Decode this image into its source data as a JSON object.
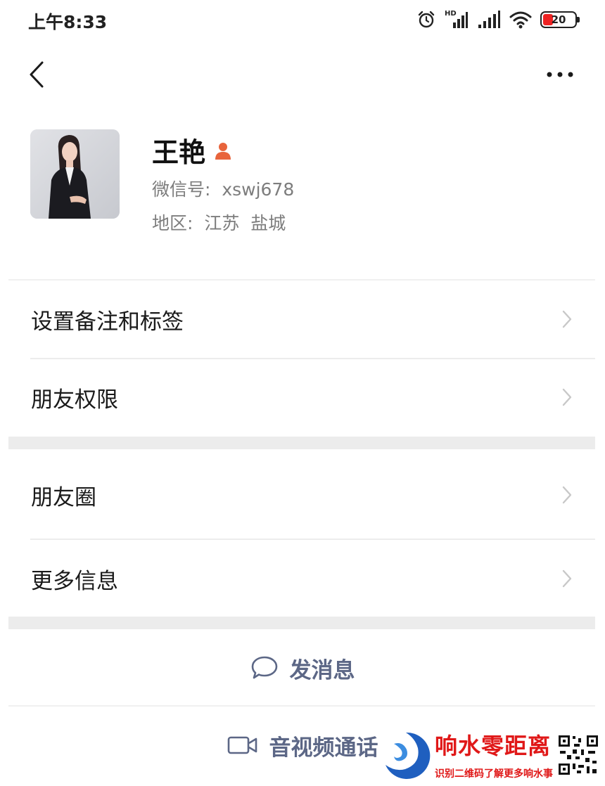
{
  "status_bar": {
    "time": "上午8:33",
    "network_label": "HD",
    "battery": "20",
    "battery_color": "#e22222"
  },
  "nav": {
    "back_icon": "chevron-left-icon",
    "more_icon": "more-dots-icon"
  },
  "profile": {
    "name": "王艳",
    "badge_icon": "person-badge-icon",
    "badge_color": "#e8643c",
    "wechat_id": "微信号:  xswj678",
    "region": "地区:  江苏  盐城"
  },
  "menu": {
    "items": [
      {
        "label": "设置备注和标签"
      },
      {
        "label": "朋友权限"
      },
      {
        "label": "朋友圈"
      },
      {
        "label": "更多信息"
      }
    ]
  },
  "actions": {
    "message": {
      "label": "发消息",
      "icon": "chat-bubble-icon"
    },
    "call": {
      "label": "音视频通话",
      "icon": "video-camera-icon"
    },
    "accent_color": "#5c6786"
  },
  "watermark": {
    "title": "响水零距离",
    "subtitle": "识别二维码了解更多响水事",
    "color": "#e01818"
  }
}
